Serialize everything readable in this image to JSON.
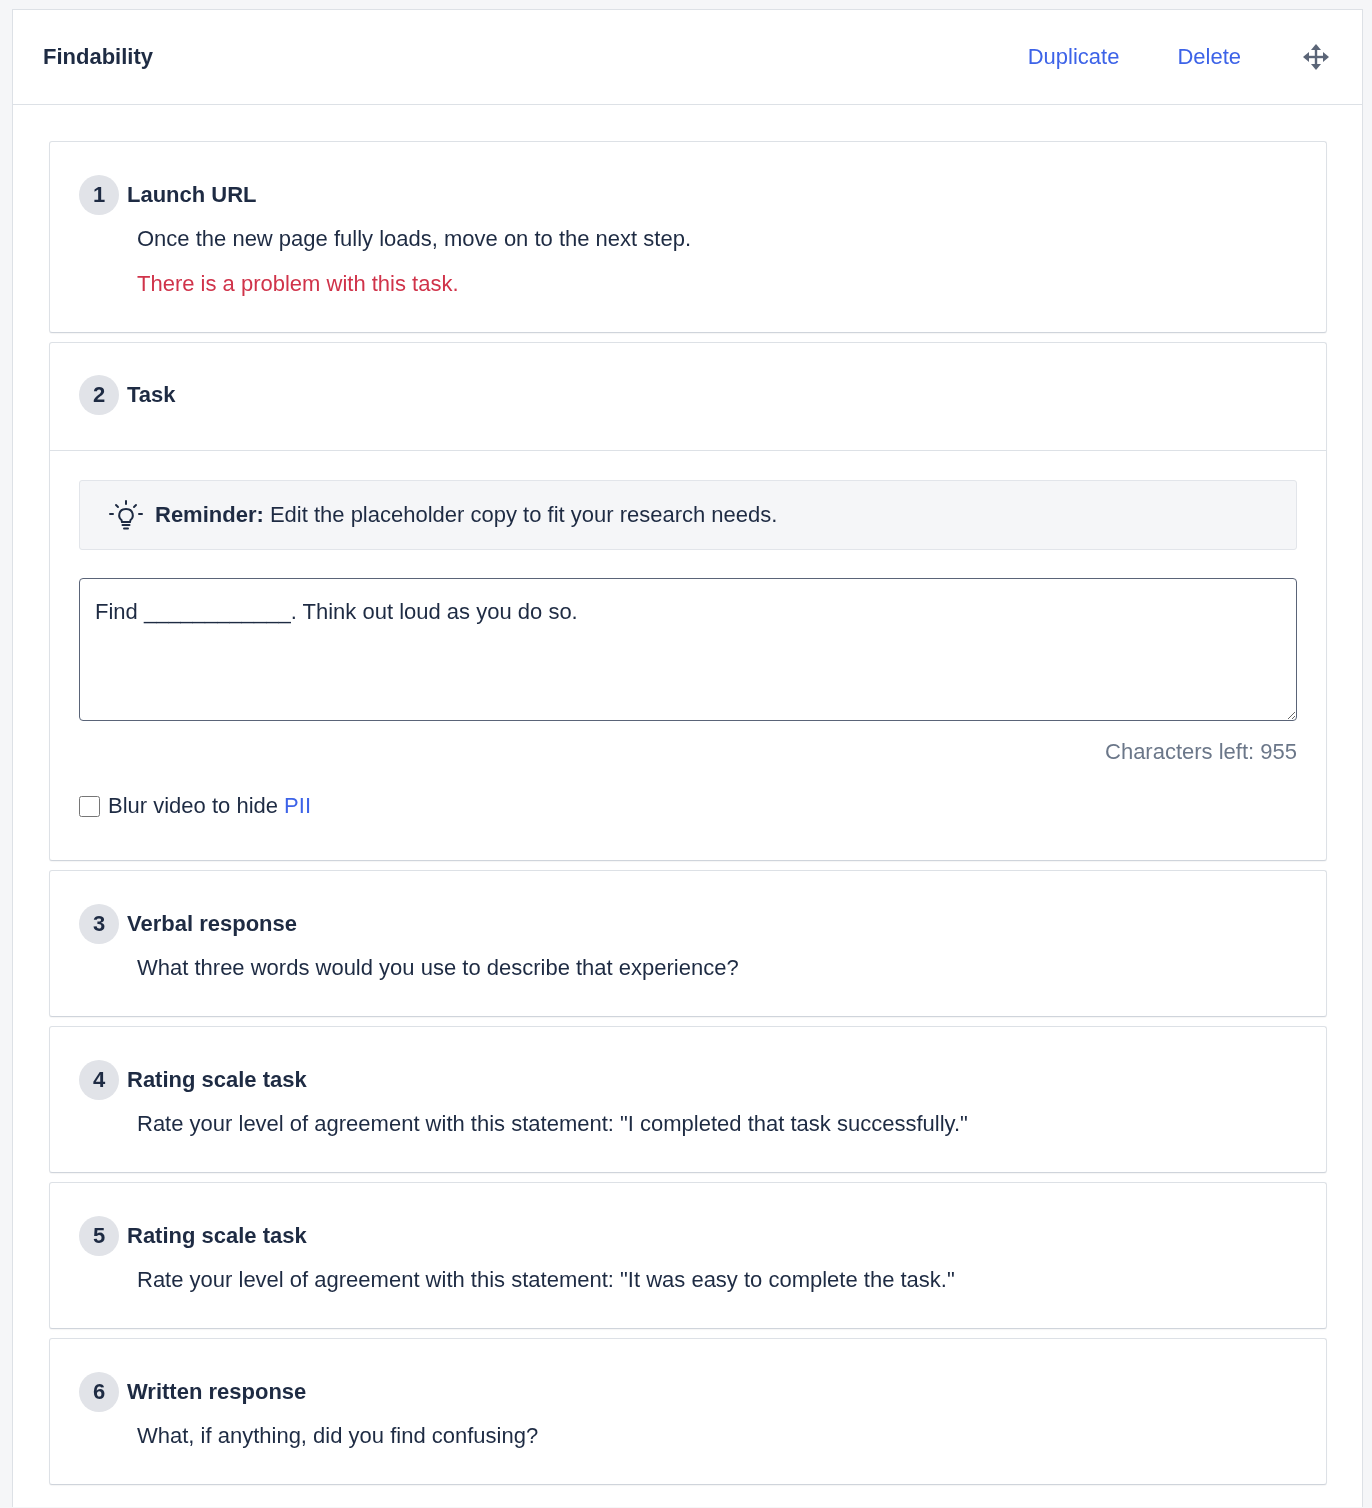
{
  "panel": {
    "title": "Findability",
    "actions": [
      {
        "label": "Duplicate"
      },
      {
        "label": "Delete"
      }
    ]
  },
  "steps": [
    {
      "kind": "summary",
      "number": "1",
      "title": "Launch URL",
      "description": "Once the new page fully loads, move on to the next step.",
      "error": "There is a problem with this task."
    },
    {
      "kind": "task",
      "number": "2",
      "title": "Task",
      "reminder": "**Reminder:** Edit the placeholder copy to fit your research needs.",
      "value": "Find ____________. Think out loud as you do so.",
      "characters_left": "Characters left: 955",
      "checkbox": {
        "label": "Blur video to hide",
        "link": "PII",
        "checked": false
      }
    },
    {
      "kind": "summary",
      "number": "3",
      "title": "Verbal response",
      "description": "What three words would you use to describe that experience?"
    },
    {
      "kind": "summary",
      "number": "4",
      "title": "Rating scale task",
      "description": "Rate your level of agreement with this statement: \"I completed that task successfully.\""
    },
    {
      "kind": "summary",
      "number": "5",
      "title": "Rating scale task",
      "description": "Rate your level of agreement with this statement: \"It was easy to complete the task.\""
    },
    {
      "kind": "summary",
      "number": "6",
      "title": "Written response",
      "description": "What, if anything, did you find confusing?"
    }
  ]
}
